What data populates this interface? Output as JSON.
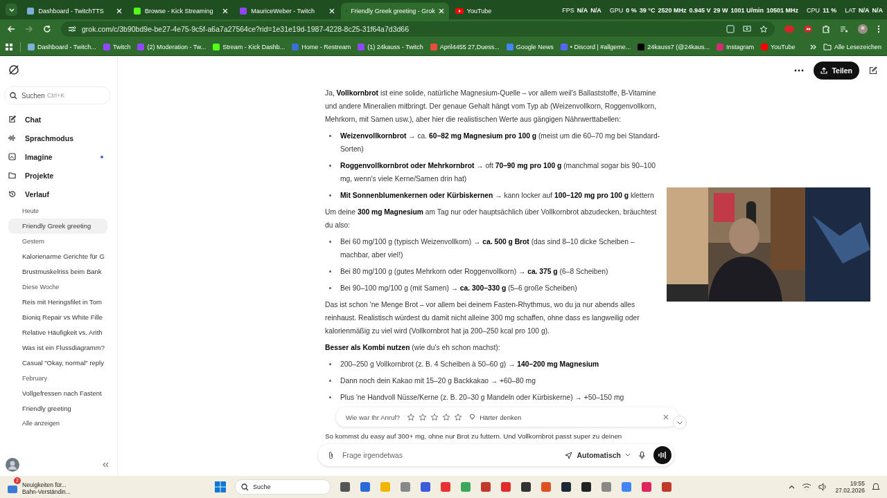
{
  "browser": {
    "tabs": [
      {
        "title": "Dashboard - TwitchTTS",
        "kind": "tts",
        "selected": false
      },
      {
        "title": "Browse - Kick Streaming",
        "kind": "kick",
        "selected": false
      },
      {
        "title": "MauriceWeber - Twitch",
        "kind": "twitch",
        "selected": false
      },
      {
        "title": "Friendly Greek greeting - Grok",
        "kind": "grok",
        "selected": true
      },
      {
        "title": "YouTube",
        "kind": "youtube",
        "selected": false
      }
    ],
    "osd": [
      {
        "label": "FPS",
        "values": [
          "N/A",
          "N/A"
        ]
      },
      {
        "label": "GPU",
        "values": [
          "0 %",
          "39 °C",
          "2520 MHz",
          "0.945 V",
          "29 W",
          "1001 U/min",
          "10501 MHz"
        ]
      },
      {
        "label": "CPU",
        "values": [
          "11 %"
        ]
      },
      {
        "label": "LAT",
        "values": [
          "N/A",
          "N/A"
        ]
      }
    ],
    "url": "grok.com/c/3b90bd9e-be27-4e75-9c5f-a6a7a27564ce?rid=1e31e19d-1987-4228-8c25-31f64a7d3d66",
    "bookmarks": [
      {
        "title": "Dashboard - Twitch...",
        "kind": "tts"
      },
      {
        "title": "Twitch",
        "kind": "twitch"
      },
      {
        "title": "(2) Moderation - Tw...",
        "kind": "twitch"
      },
      {
        "title": "Stream - Kick Dashb...",
        "kind": "kick"
      },
      {
        "title": "Home - Restream",
        "kind": "restream"
      },
      {
        "title": "(1) 24kauss - Twitch",
        "kind": "twitch"
      },
      {
        "title": "April4455 27,Duess...",
        "kind": "calendar"
      },
      {
        "title": "Google News",
        "kind": "news"
      },
      {
        "title": "• Discord | #allgeme...",
        "kind": "discord"
      },
      {
        "title": "24kauss7 (@24kaus...",
        "kind": "tiktok"
      },
      {
        "title": "Instagram",
        "kind": "instagram"
      },
      {
        "title": "YouTube",
        "kind": "youtube"
      }
    ],
    "all_bookmarks": "Alle Lesezeichen"
  },
  "sidebar": {
    "search": {
      "placeholder": "Suchen",
      "shortcut": "Ctrl+K"
    },
    "nav": [
      {
        "label": "Chat",
        "kind": "chat",
        "dot": false
      },
      {
        "label": "Sprachmodus",
        "kind": "voice",
        "dot": false
      },
      {
        "label": "Imagine",
        "kind": "imagine",
        "dot": true
      },
      {
        "label": "Projekte",
        "kind": "folder",
        "dot": false
      },
      {
        "label": "Verlauf",
        "kind": "history",
        "dot": false
      }
    ],
    "history": [
      {
        "kind": "heading",
        "text": "Heute"
      },
      {
        "kind": "item",
        "text": "Friendly Greek greeting",
        "selected": true
      },
      {
        "kind": "heading",
        "text": "Gestern"
      },
      {
        "kind": "item",
        "text": "Kalorienarme Gerichte für G",
        "selected": false
      },
      {
        "kind": "item",
        "text": "Brustmuskelriss beim Bank",
        "selected": false
      },
      {
        "kind": "heading",
        "text": "Diese Woche"
      },
      {
        "kind": "item",
        "text": "Reis mit Heringsfilet in Tom",
        "selected": false
      },
      {
        "kind": "item",
        "text": "Bioniq Repair vs White Fille",
        "selected": false
      },
      {
        "kind": "item",
        "text": "Relative Häufigkeit vs. Arith",
        "selected": false
      },
      {
        "kind": "item",
        "text": "Was ist ein Flussdiagramm?",
        "selected": false
      },
      {
        "kind": "item",
        "text": "Casual \"Okay, normal\" reply",
        "selected": false
      },
      {
        "kind": "heading",
        "text": "February"
      },
      {
        "kind": "item",
        "text": "Vollgefressen nach Fastent",
        "selected": false
      },
      {
        "kind": "item",
        "text": "Friendly greeting",
        "selected": false
      },
      {
        "kind": "link",
        "text": "Alle anzeigen"
      }
    ]
  },
  "header": {
    "share": "Teilen"
  },
  "message": [
    {
      "kind": "p",
      "text": "Ja, **Vollkornbrot** ist eine solide, natürliche Magnesium-Quelle – vor allem weil's Ballaststoffe, B-Vitamine und andere Mineralien mitbringt. Der genaue Gehalt hängt vom Typ ab (Weizenvollkorn, Roggenvollkorn, Mehrkorn, mit Samen usw.), aber hier die realistischen Werte aus gängigen Nährwerttabellen:"
    },
    {
      "kind": "ul",
      "items": [
        "**Weizenvollkornbrot** → ca. **60–82 mg Magnesium pro 100 g** (meist um die 60–70 mg bei Standard-Sorten)",
        "**Roggenvollkornbrot oder Mehrkornbrot** → oft **70–90 mg pro 100 g** (manchmal sogar bis 90–100 mg, wenn's viele Kerne/Samen drin hat)",
        "**Mit Sonnenblumenkernen oder Kürbiskernen** → kann locker auf **100–120 mg pro 100 g** klettern"
      ]
    },
    {
      "kind": "p",
      "text": "Um deine **300 mg Magnesium** am Tag nur oder hauptsächlich über Vollkornbrot abzudecken, bräuchtest du also:"
    },
    {
      "kind": "ul",
      "items": [
        "Bei 60 mg/100 g (typisch Weizenvollkorn) → **ca. 500 g Brot** (das sind 8–10 dicke Scheiben – machbar, aber viel!)",
        "Bei 80 mg/100 g (gutes Mehrkorn oder Roggenvollkorn) → **ca. 375 g** (6–8 Scheiben)",
        "Bei 90–100 mg/100 g (mit Samen) → **ca. 300–330 g** (5–6 große Scheiben)"
      ]
    },
    {
      "kind": "p",
      "text": "Das ist schon 'ne Menge Brot – vor allem bei deinem Fasten-Rhythmus, wo du ja nur abends alles reinhaust. Realistisch würdest du damit nicht alleine 300 mg schaffen, ohne dass es langweilig oder kalorienmäßig zu viel wird (Vollkornbrot hat ja 200–250 kcal pro 100 g)."
    },
    {
      "kind": "p",
      "text": "**Besser als Kombi nutzen** (wie du's eh schon machst):"
    },
    {
      "kind": "ul",
      "items": [
        "200–250 g Vollkornbrot (z. B. 4 Scheiben à 50–60 g) → **140–200 mg Magnesium**",
        "Dann noch dein Kakao mit 15–20 g Backkakao → +60–80 mg",
        "Plus 'ne Handvoll Nüsse/Kerne (z. B. 20–30 g Mandeln oder Kürbiskerne) → +50–150 mg"
      ]
    }
  ],
  "rating": {
    "question": "Wie war Ihr Anruf?",
    "stars": 0,
    "chip": "Härter denken"
  },
  "trailing_line": "So kommst du easy auf 300+ mg, ohne nur Brot zu futtern. Und Vollkornbrot passt super zu deinen",
  "composer": {
    "placeholder": "Frage irgendetwas",
    "mode": "Automatisch"
  },
  "taskbar": {
    "news_badge": "2",
    "news": [
      "Neuigkeiten für...",
      "Bahn-Verständin..."
    ],
    "search": "Suche",
    "time": "19:55",
    "date": "27.02.2026"
  }
}
